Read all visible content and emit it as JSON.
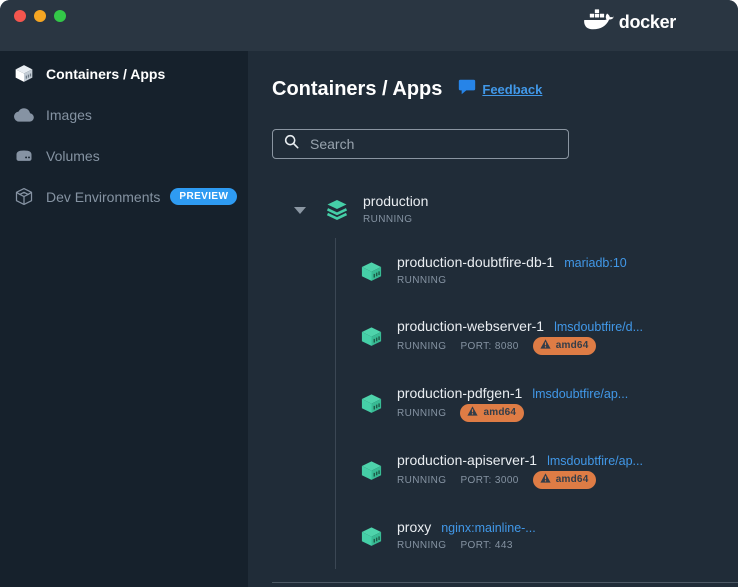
{
  "titlebar": {
    "traffic_lights": [
      "close",
      "minimize",
      "maximize"
    ],
    "logo_label": "docker"
  },
  "sidebar": {
    "items": [
      {
        "label": "Containers / Apps",
        "icon": "containers-icon",
        "active": true,
        "badge": null
      },
      {
        "label": "Images",
        "icon": "images-icon",
        "active": false,
        "badge": null
      },
      {
        "label": "Volumes",
        "icon": "volumes-icon",
        "active": false,
        "badge": null
      },
      {
        "label": "Dev Environments",
        "icon": "dev-environments-icon",
        "active": false,
        "badge": "PREVIEW"
      }
    ]
  },
  "main": {
    "title": "Containers / Apps",
    "feedback": {
      "label": "Feedback",
      "icon": "feedback-icon"
    },
    "search": {
      "placeholder": "Search",
      "value": "",
      "icon": "search-icon"
    },
    "group": {
      "name": "production",
      "status": "RUNNING",
      "icon": "layers-icon",
      "expanded": true
    },
    "containers": [
      {
        "name": "production-doubtfire-db-1",
        "image": "mariadb:10",
        "status": "RUNNING",
        "port": null,
        "arch_badge": null,
        "icon": "container-icon"
      },
      {
        "name": "production-webserver-1",
        "image": "lmsdoubtfire/d...",
        "status": "RUNNING",
        "port": "PORT: 8080",
        "arch_badge": "amd64",
        "icon": "container-icon"
      },
      {
        "name": "production-pdfgen-1",
        "image": "lmsdoubtfire/ap...",
        "status": "RUNNING",
        "port": null,
        "arch_badge": "amd64",
        "icon": "container-icon"
      },
      {
        "name": "production-apiserver-1",
        "image": "lmsdoubtfire/ap...",
        "status": "RUNNING",
        "port": "PORT: 3000",
        "arch_badge": "amd64",
        "icon": "container-icon"
      },
      {
        "name": "proxy",
        "image": "nginx:mainline-...",
        "status": "RUNNING",
        "port": "PORT: 443",
        "arch_badge": null,
        "icon": "container-icon"
      }
    ]
  },
  "colors": {
    "titlebar_bg": "#2a3642",
    "sidebar_bg": "#16212c",
    "main_bg": "#202c38",
    "accent_teal": "#45cfa7",
    "accent_blue": "#4198e8",
    "preview_badge_bg": "#2e9bf2",
    "arch_badge_bg": "#de7c45",
    "text_primary": "#e9edf1",
    "text_muted": "#8593a2"
  }
}
